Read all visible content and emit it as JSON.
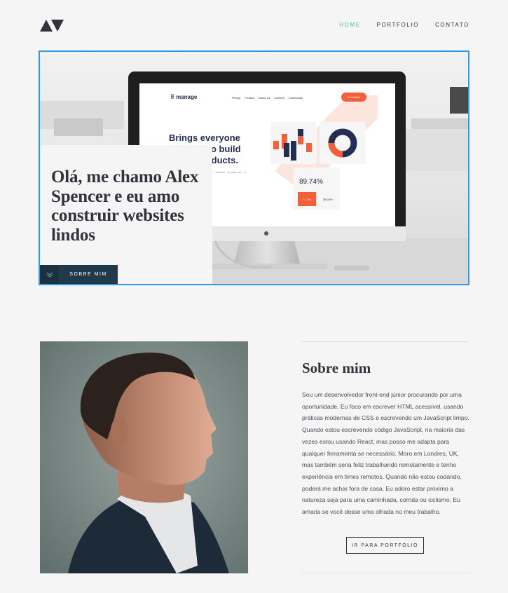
{
  "header": {
    "logo_icon": "triangle-logo-icon",
    "nav": [
      {
        "label": "HOME",
        "active": true
      },
      {
        "label": "PORTFOLIO",
        "active": false
      },
      {
        "label": "CONTATO",
        "active": false
      }
    ]
  },
  "hero": {
    "title": "Olá, me chamo Alex Spencer e eu amo construir websites lindos",
    "button_label": "SOBRE MIM",
    "button_icon": "chevrons-down-icon",
    "mockup": {
      "logo": "⠿ manage",
      "nav": [
        "Pricing",
        "Product",
        "About Us",
        "Careers",
        "Community"
      ],
      "cta": "Get Started",
      "headline": "Brings everyone together to build better products.",
      "sub": "...software ...ay tasks can ...ct.",
      "stat": "89.74%",
      "badge_1": "+1.3%",
      "badge_2": "88.24%"
    }
  },
  "about": {
    "title": "Sobre mim",
    "text": "Sou um desenvolvedor front-end júnior procurando por uma oportunidade. Eu foco em escrever HTML acessível, usando práticas modernas de CSS e escrevendo um JavaScript limpo. Quando estou escrevendo código JavaScript, na maioria das vezes estou usando React, mas posso me adapta para qualquer ferramenta se necessário. Moro em Londres, UK, mas também seria feliz trabalhando remotamente e tenho experiência em times remotos. Quando não estou codando, poderá me achar fora de casa. Eu adoro estar próximo a natureza seja para uma caminhada, corrida ou ciclismo. Eu amaria se você desse uma olhada no meu trabalho.",
    "button_label": "IR PARA PORTFOLIO"
  },
  "colors": {
    "accent": "#5fb4a2",
    "dark_blue": "#203a4c",
    "text": "#33323d",
    "mockup_orange": "#f25f3a",
    "mockup_navy": "#242d52",
    "focus_border": "#2f9be8"
  }
}
